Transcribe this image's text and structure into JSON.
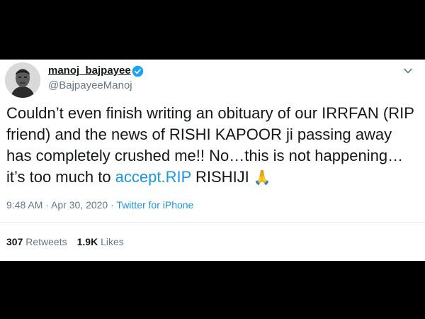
{
  "tweet": {
    "author": {
      "display_name": "manoj_bajpayee",
      "handle": "@BajpayeeManoj"
    },
    "text": {
      "part1": "Couldn’t even finish writing an obituary of our IRRFAN (RIP friend) and the news of RISHI KAPOOR ji passing away has completely crushed me!! No…this is not happening…it’s too much to ",
      "link": "accept.RIP",
      "part2": " RISHIJI ",
      "emoji": "🙏"
    },
    "meta": {
      "time": "9:48 AM",
      "separator": " · ",
      "date": "Apr 30, 2020",
      "separator2": " · ",
      "source": "Twitter for iPhone"
    },
    "stats": {
      "retweets_count": "307",
      "retweets_label": " Retweets",
      "likes_count": "1.9K",
      "likes_label": " Likes"
    }
  },
  "icons": {
    "verified": "verified-badge-icon",
    "menu": "chevron-down-icon"
  },
  "colors": {
    "link": "#1b95e0",
    "text": "#14171a",
    "secondary": "#657786",
    "verified": "#1da1f2"
  }
}
